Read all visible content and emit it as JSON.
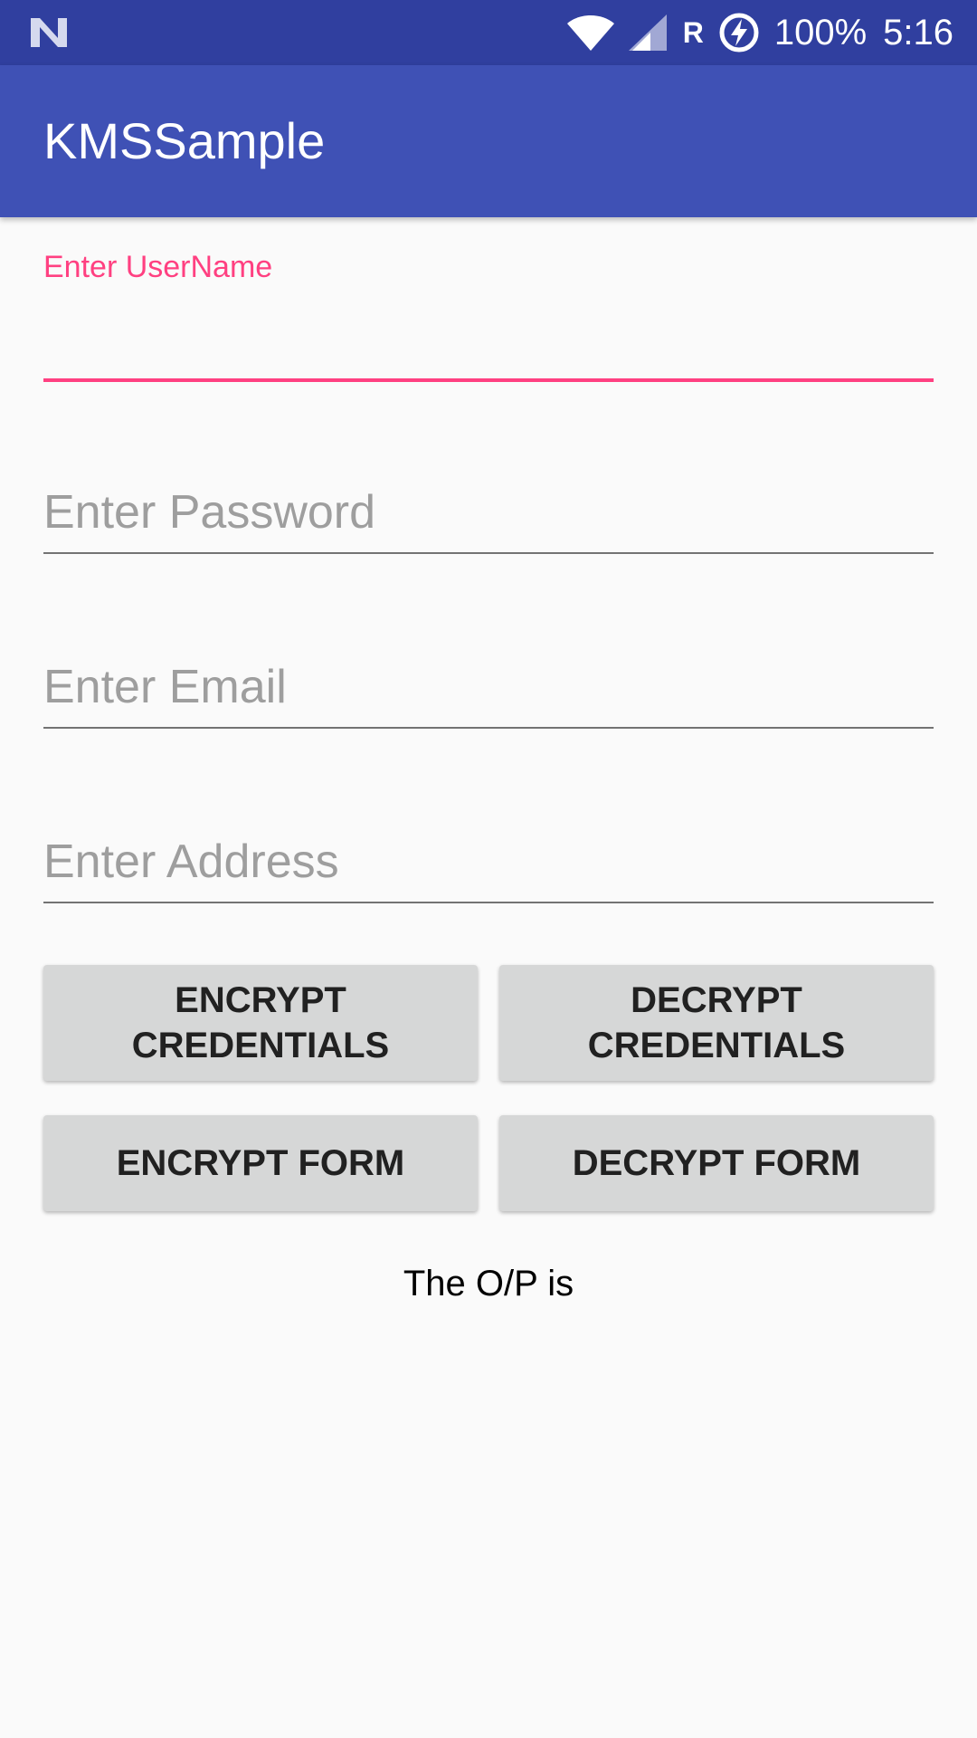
{
  "status_bar": {
    "network_indicator": "R",
    "battery_percent": "100%",
    "time": "5:16",
    "icons": [
      "n-logo-icon",
      "wifi-icon",
      "cell-signal-icon",
      "battery-charging-icon"
    ]
  },
  "app_bar": {
    "title": "KMSSample"
  },
  "form": {
    "username": {
      "label": "Enter UserName",
      "value": "",
      "placeholder": ""
    },
    "password": {
      "value": "",
      "placeholder": "Enter Password"
    },
    "email": {
      "value": "",
      "placeholder": "Enter Email"
    },
    "address": {
      "value": "",
      "placeholder": "Enter Address"
    }
  },
  "buttons": {
    "encrypt_credentials": "ENCRYPT CREDENTIALS",
    "decrypt_credentials": "DECRYPT CREDENTIALS",
    "encrypt_form": "ENCRYPT FORM",
    "decrypt_form": "DECRYPT FORM"
  },
  "output": {
    "text": "The O/P is"
  },
  "colors": {
    "status_bar": "#303f9f",
    "app_bar": "#3f51b5",
    "accent": "#ff4081",
    "button_bg": "#d6d7d7",
    "background": "#fafafa"
  }
}
